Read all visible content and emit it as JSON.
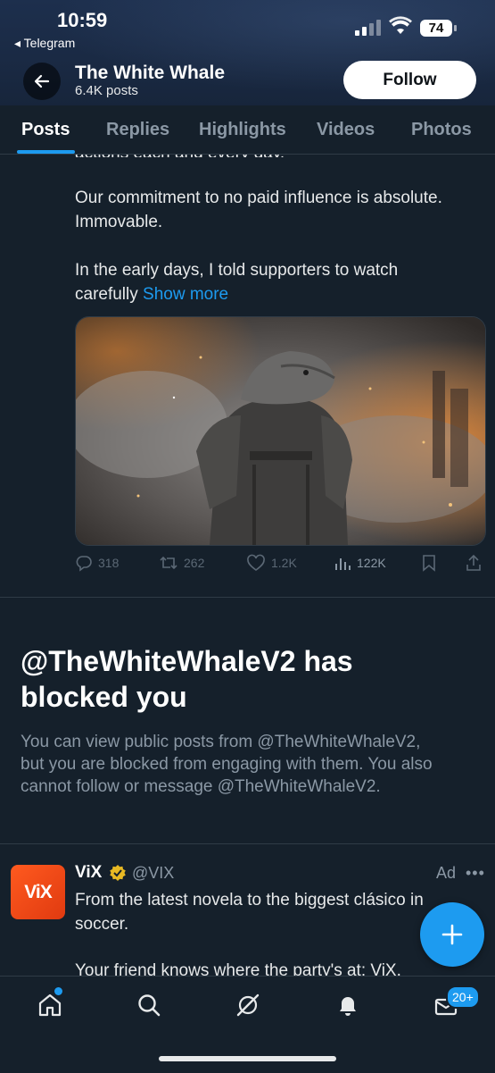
{
  "status_bar": {
    "time": "10:59",
    "back_app": "◂ Telegram",
    "battery": "74"
  },
  "profile": {
    "name": "The White Whale",
    "posts_count": "6.4K posts",
    "follow_label": "Follow"
  },
  "tabs": [
    "Posts",
    "Replies",
    "Highlights",
    "Videos",
    "Photos"
  ],
  "post": {
    "cut_line": "actions each and every day.",
    "paragraph1_line1": "Our commitment to no paid influence is absolute.",
    "paragraph1_line2": "Immovable.",
    "paragraph2_line1": "In the early days, I told supporters to watch",
    "paragraph2_line2": "carefully",
    "show_more": "Show more",
    "replies": "318",
    "reposts": "262",
    "likes": "1.2K",
    "views": "122K"
  },
  "blocked": {
    "title_line1": "@TheWhiteWhaleV2 has",
    "title_line2": "blocked you",
    "desc_line1": "You can view public posts from @TheWhiteWhaleV2,",
    "desc_line2": "but you are blocked from engaging with them. You also",
    "desc_line3": "cannot follow or message @TheWhiteWhaleV2."
  },
  "ad": {
    "logo_text": "ViX",
    "name": "ViX",
    "handle": "@VIX",
    "label": "Ad",
    "more": "•••",
    "text_line1": "From the latest novela to the biggest clásico in",
    "text_line2": "soccer.",
    "text_line3": "Your friend knows where the party's at: ViX."
  },
  "nav": {
    "messages_badge": "20+"
  },
  "colors": {
    "accent": "#1d9bf0",
    "background": "#15202b",
    "muted": "#8b98a5"
  }
}
